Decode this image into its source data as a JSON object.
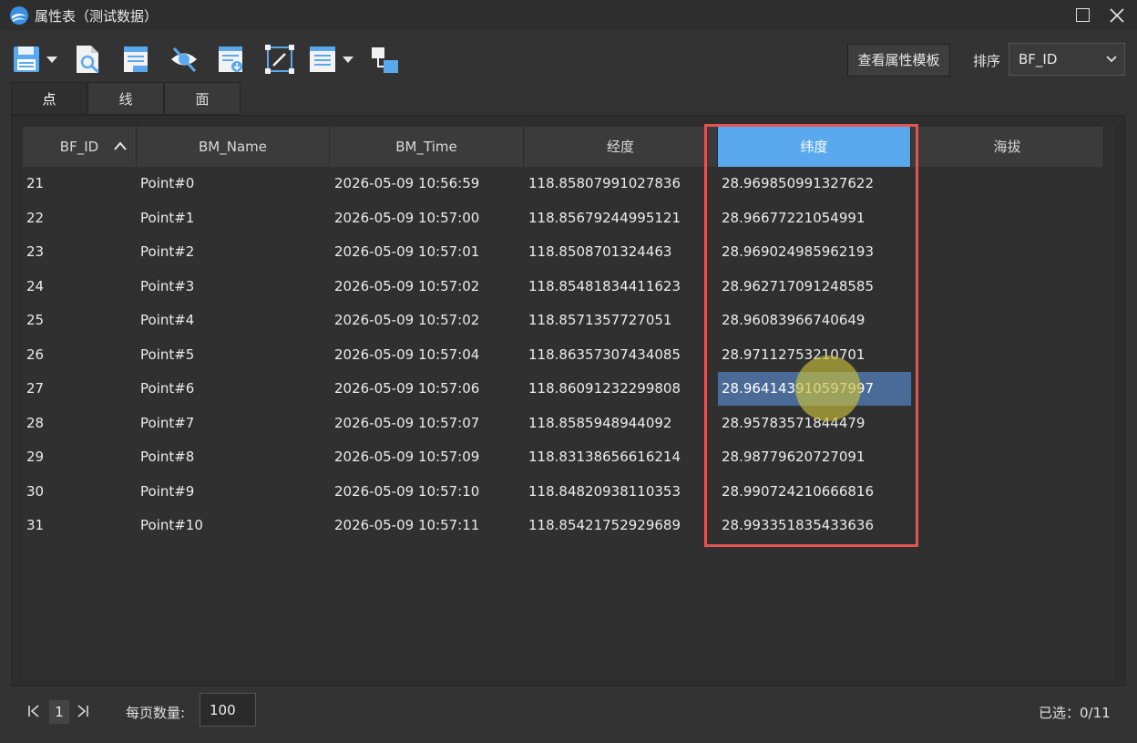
{
  "window": {
    "title": "属性表（测试数据）"
  },
  "tabs": [
    {
      "label": "点"
    },
    {
      "label": "线"
    },
    {
      "label": "面"
    }
  ],
  "toolbar": {
    "view_template_label": "查看属性模板",
    "sort_label": "排序",
    "sort_value": "BF_ID"
  },
  "table": {
    "columns": [
      "BF_ID",
      "BM_Name",
      "BM_Time",
      "经度",
      "纬度",
      "海拔"
    ],
    "rows": [
      [
        "21",
        "Point#0",
        "2026-05-09 10:56:59",
        "118.85807991027836",
        "28.969850991327622",
        ""
      ],
      [
        "22",
        "Point#1",
        "2026-05-09 10:57:00",
        "118.85679244995121",
        "28.96677221054991",
        ""
      ],
      [
        "23",
        "Point#2",
        "2026-05-09 10:57:01",
        "118.8508701324463",
        "28.969024985962193",
        ""
      ],
      [
        "24",
        "Point#3",
        "2026-05-09 10:57:02",
        "118.85481834411623",
        "28.962717091248585",
        ""
      ],
      [
        "25",
        "Point#4",
        "2026-05-09 10:57:02",
        "118.8571357727051",
        "28.96083966740649",
        ""
      ],
      [
        "26",
        "Point#5",
        "2026-05-09 10:57:04",
        "118.86357307434085",
        "28.97112753210701",
        ""
      ],
      [
        "27",
        "Point#6",
        "2026-05-09 10:57:06",
        "118.86091232299808",
        "28.964143910597997",
        ""
      ],
      [
        "28",
        "Point#7",
        "2026-05-09 10:57:07",
        "118.8585948944092",
        "28.95783571844479",
        ""
      ],
      [
        "29",
        "Point#8",
        "2026-05-09 10:57:09",
        "118.83138656616214",
        "28.98779620727091",
        ""
      ],
      [
        "30",
        "Point#9",
        "2026-05-09 10:57:10",
        "118.84820938110353",
        "28.990724210666816",
        ""
      ],
      [
        "31",
        "Point#10",
        "2026-05-09 10:57:11",
        "118.85421752929689",
        "28.993351835433636",
        ""
      ]
    ]
  },
  "pager": {
    "page": "1",
    "per_page_label": "每页数量:",
    "per_page_value": "100",
    "selected": "已选：0/11"
  },
  "colors": {
    "accent": "#5aa9ee",
    "highlight": "#4a6b98",
    "annotation": "#e45454"
  },
  "icons": [
    "save-icon",
    "preview-icon",
    "export-icon",
    "hide-icon",
    "import-icon",
    "edit-icon",
    "list-icon",
    "link-icon"
  ]
}
